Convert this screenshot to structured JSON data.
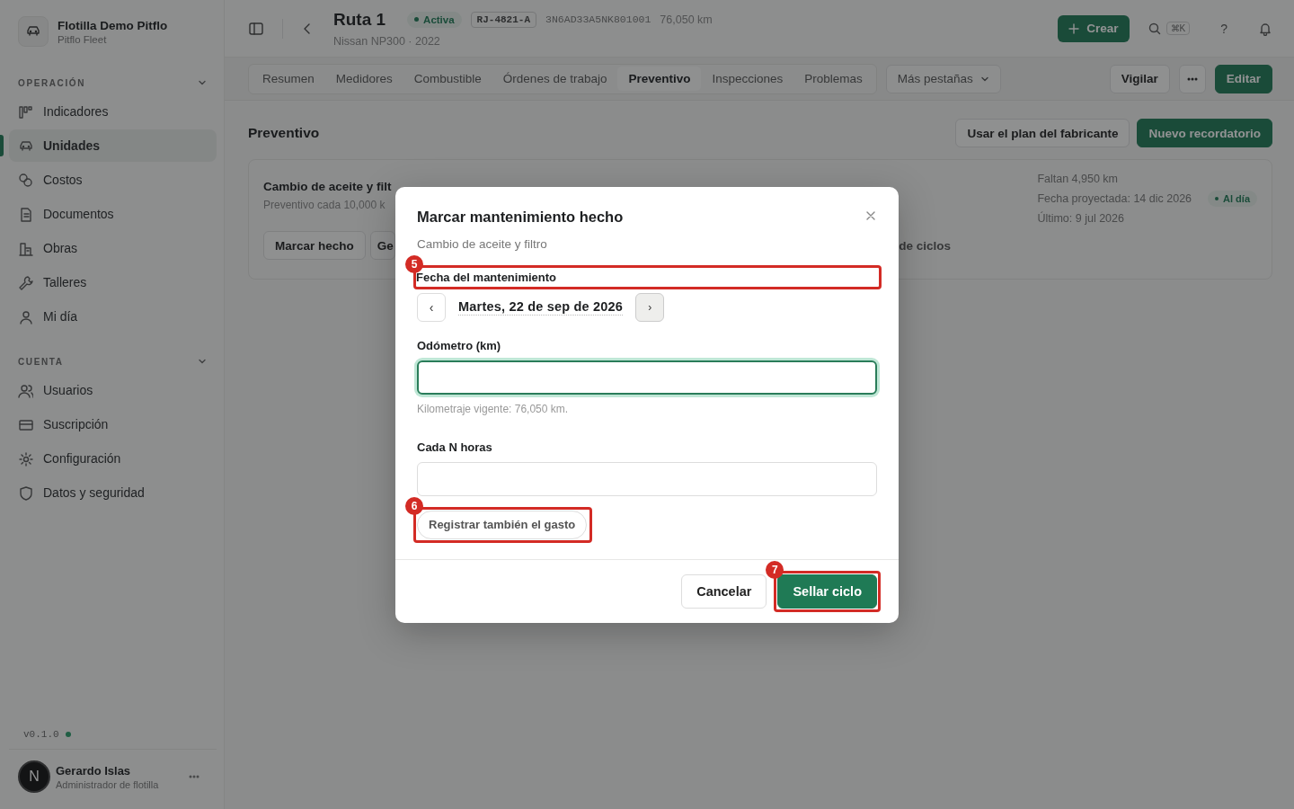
{
  "sidebar": {
    "org": {
      "name": "Flotilla Demo Pitflo",
      "subtitle": "Pitflo Fleet"
    },
    "sections": [
      {
        "title": "OPERACIÓN",
        "expanded": true,
        "items": [
          {
            "label": "Indicadores",
            "selected": false
          },
          {
            "label": "Unidades",
            "selected": true
          },
          {
            "label": "Costos",
            "selected": false
          },
          {
            "label": "Documentos",
            "selected": false
          },
          {
            "label": "Obras",
            "selected": false
          },
          {
            "label": "Talleres",
            "selected": false
          },
          {
            "label": "Mi día",
            "selected": false
          }
        ]
      },
      {
        "title": "CUENTA",
        "expanded": true,
        "items": [
          {
            "label": "Usuarios",
            "selected": false
          },
          {
            "label": "Suscripción",
            "selected": false
          },
          {
            "label": "Configuración",
            "selected": false
          },
          {
            "label": "Datos y seguridad",
            "selected": false
          }
        ]
      }
    ],
    "version": "v0.1.0",
    "user": {
      "initial": "N",
      "name": "Gerardo Islas",
      "role": "Administrador de flotilla"
    }
  },
  "header": {
    "title": "Ruta 1",
    "status": "Activa",
    "plate": "RJ-4821-A",
    "vin": "3N6AD33A5NK801001",
    "odometer": "76,050 km",
    "subtitle": "Nissan NP300 · 2022",
    "create_button": "Crear",
    "shortcut": "⌘K",
    "help": "?"
  },
  "tabs": [
    {
      "label": "Resumen",
      "selected": false
    },
    {
      "label": "Medidores",
      "selected": false
    },
    {
      "label": "Combustible",
      "selected": false
    },
    {
      "label": "Órdenes de trabajo",
      "selected": false
    },
    {
      "label": "Preventivo",
      "selected": true
    },
    {
      "label": "Inspecciones",
      "selected": false
    },
    {
      "label": "Problemas",
      "selected": false
    }
  ],
  "more_tabs": "Más pestañas",
  "tab_actions": {
    "watch": "Vigilar",
    "edit": "Editar"
  },
  "section": {
    "title": "Preventivo",
    "buttons": [
      "Usar el plan del fabricante",
      "Nuevo recordatorio"
    ]
  },
  "reminder": {
    "title": "Cambio de aceite y filt",
    "subtitle": "Preventivo cada 10,000 k",
    "buttons": [
      "Marcar hecho",
      "Ge"
    ],
    "link": "de ciclos",
    "stats": [
      "Faltan 4,950 km",
      "Fecha proyectada: 14 dic 2026",
      "Último: 9 jul 2026"
    ],
    "badge": "Al día"
  },
  "modal": {
    "title": "Marcar mantenimiento hecho",
    "subtitle": "Cambio de aceite y filtro",
    "date_field": {
      "label": "Fecha del mantenimiento",
      "step": "5",
      "prev": "‹",
      "value": "Martes, 22 de sep de 2026",
      "next": "›"
    },
    "odometer_field": {
      "label": "Odómetro (km)",
      "focused": true,
      "hint": "Kilometraje vigente: 76,050 km."
    },
    "hours_field": {
      "label": "Cada N horas",
      "focused": false
    },
    "expense_button": {
      "label": "Registrar también el gasto",
      "step": "6"
    },
    "cancel": "Cancelar",
    "confirm": {
      "label": "Sellar ciclo",
      "step": "7"
    }
  }
}
